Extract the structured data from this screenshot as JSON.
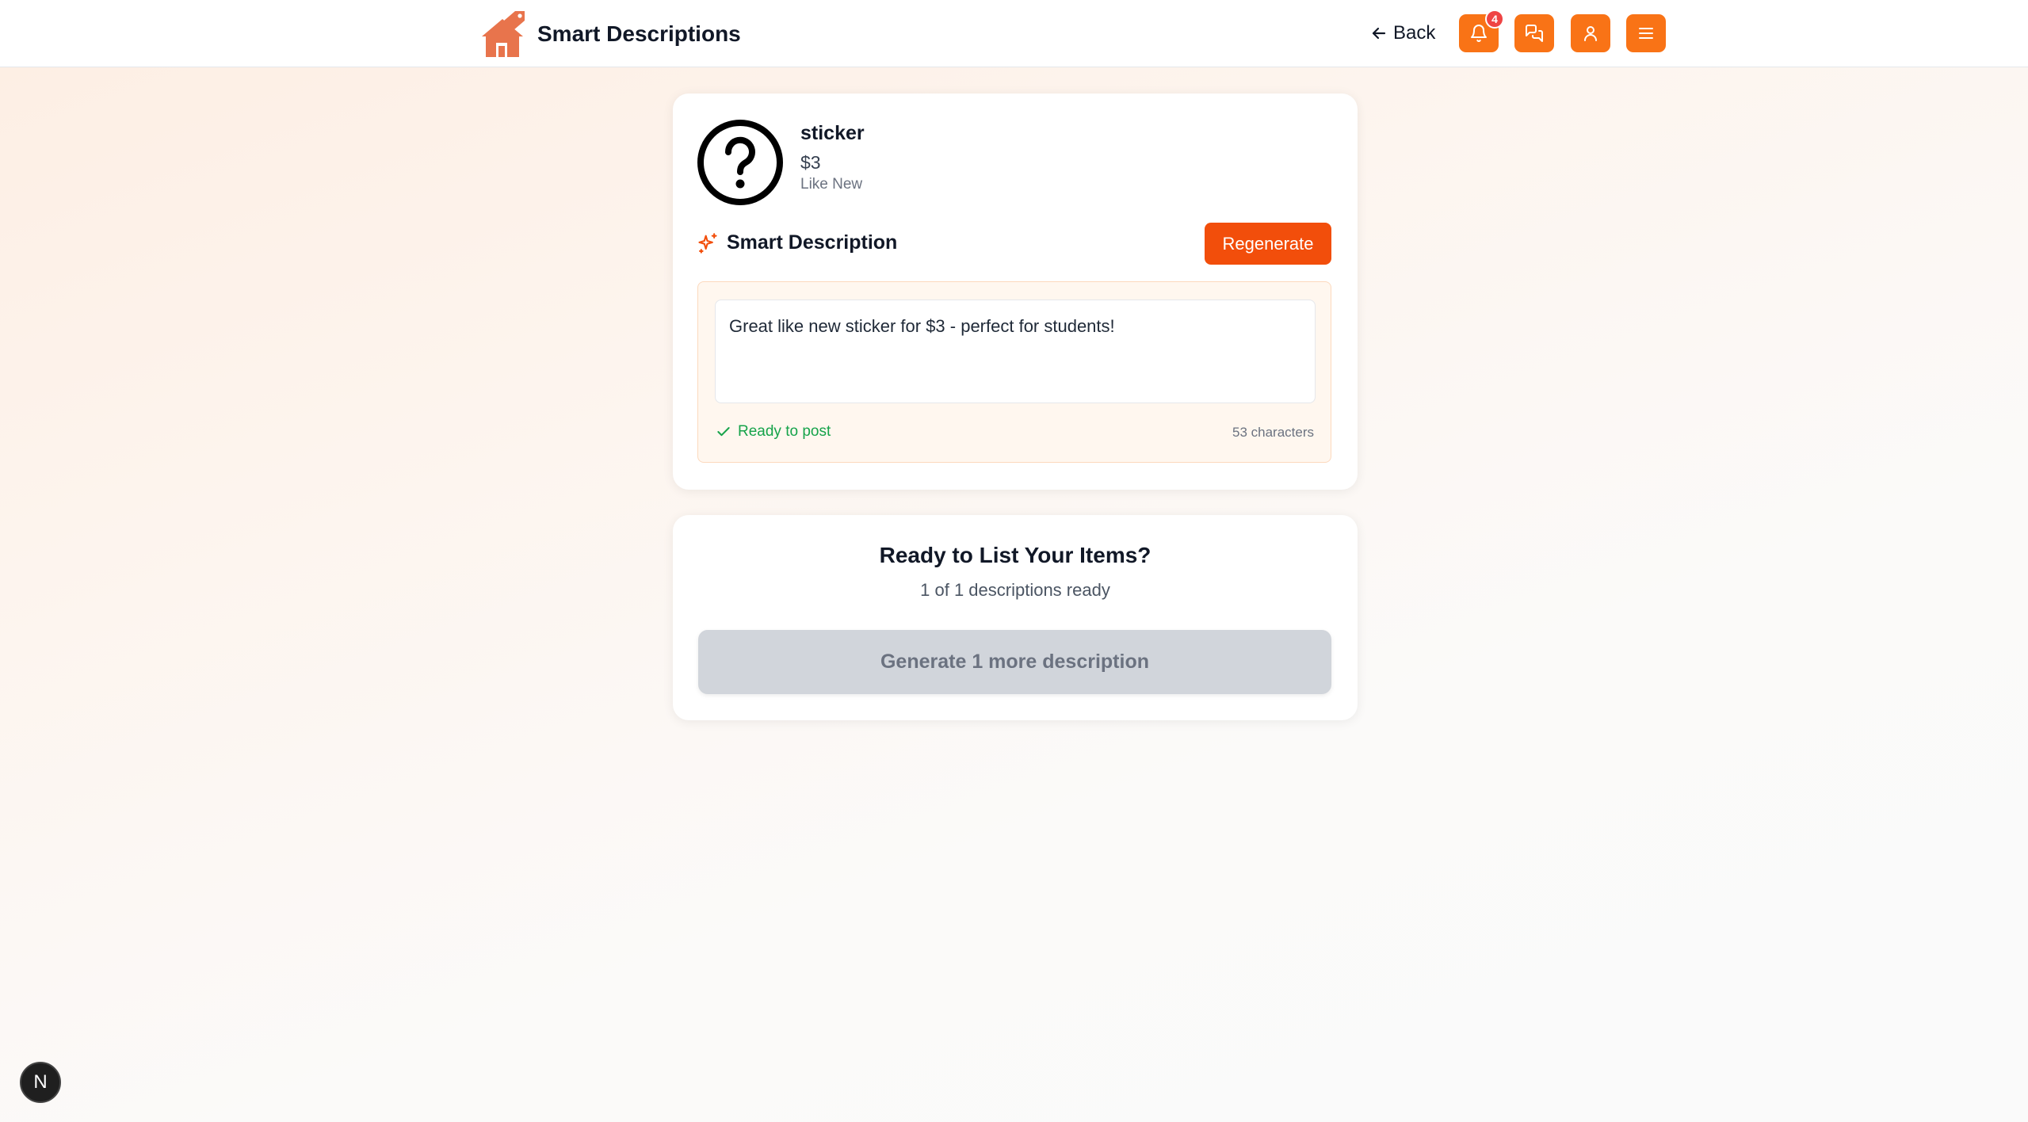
{
  "header": {
    "title": "Smart Descriptions",
    "back_label": "Back",
    "notification_count": "4",
    "icons": [
      "house-tag-logo",
      "arrow-left-icon",
      "bell-icon",
      "chat-icon",
      "user-icon",
      "menu-icon"
    ],
    "accent_color": "#f97316"
  },
  "item": {
    "name": "sticker",
    "price": "$3",
    "condition": "Like New",
    "image_icon": "question-circle-icon"
  },
  "smart_description": {
    "heading": "Smart Description",
    "regenerate_label": "Regenerate",
    "text": "Great like new sticker for $3 - perfect for students!",
    "status": "Ready to post",
    "char_count": "53 characters"
  },
  "ready_card": {
    "title": "Ready to List Your Items?",
    "subtitle": "1 of 1 descriptions ready",
    "button_label": "Generate 1 more description"
  },
  "dev_badge": {
    "label": "N"
  }
}
